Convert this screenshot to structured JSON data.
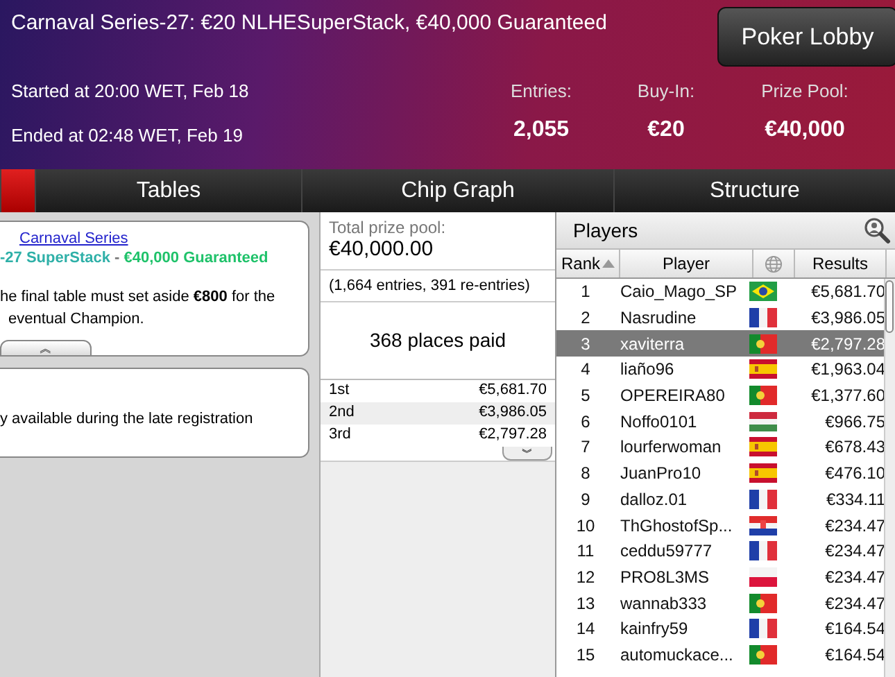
{
  "header": {
    "title": "Carnaval Series-27: €20 NLHESuperStack, €40,000 Guaranteed",
    "lobby_button": "Poker Lobby",
    "started": "Started at 20:00 WET, Feb 18",
    "ended": "Ended at 02:48 WET, Feb 19",
    "stats": [
      {
        "label": "Entries:",
        "value": "2,055"
      },
      {
        "label": "Buy-In:",
        "value": "€20"
      },
      {
        "label": "Prize Pool:",
        "value": "€40,000"
      }
    ]
  },
  "tabs": [
    {
      "selected": true
    },
    {
      "label": "Tables",
      "selected": false
    },
    {
      "label": "Chip Graph",
      "selected": false
    },
    {
      "label": "Structure",
      "selected": false
    }
  ],
  "info": {
    "link": "Carnaval Series",
    "subtitle_parts": [
      {
        "text": "-27 SuperStack",
        "color": "#2fb0a8"
      },
      {
        "text": " - ",
        "color": "#777777"
      },
      {
        "text": "€40,000 Guaranteed",
        "color": "#1fc26a"
      }
    ],
    "lines": [
      "he final table must set aside **€800** for the",
      "eventual Champion."
    ],
    "collapse": "︽",
    "note": "y available during the late registration"
  },
  "prizes": {
    "label": "Total prize pool:",
    "total": "€40,000.00",
    "entries": "(1,664 entries, 391 re-entries)",
    "paid": "368 places paid",
    "places": [
      {
        "place": "1st",
        "amount": "€5,681.70"
      },
      {
        "place": "2nd",
        "amount": "€3,986.05"
      },
      {
        "place": "3rd",
        "amount": "€2,797.28"
      }
    ],
    "expand": "︾"
  },
  "players": {
    "title": "Players",
    "columns": [
      "Rank",
      "Player",
      "Results"
    ],
    "rows": [
      {
        "rank": "1",
        "name": "Caio_Mago_SP",
        "kind": "br",
        "result": "€5,681.70",
        "selected": false
      },
      {
        "rank": "2",
        "name": "Nasrudine",
        "kind": "fr",
        "result": "€3,986.05",
        "selected": false
      },
      {
        "rank": "3",
        "name": "xaviterra",
        "kind": "pt",
        "result": "€2,797.28",
        "selected": true
      },
      {
        "rank": "4",
        "name": "liaño96",
        "kind": "es",
        "result": "€1,963.04",
        "selected": false
      },
      {
        "rank": "5",
        "name": "OPEREIRA80",
        "kind": "pt",
        "result": "€1,377.60",
        "selected": false
      },
      {
        "rank": "6",
        "name": "Noffo0101",
        "kind": "hu",
        "result": "€966.75",
        "selected": false
      },
      {
        "rank": "7",
        "name": "lourferwoman",
        "kind": "es",
        "result": "€678.43",
        "selected": false
      },
      {
        "rank": "8",
        "name": "JuanPro10",
        "kind": "es",
        "result": "€476.10",
        "selected": false
      },
      {
        "rank": "9",
        "name": "dalloz.01",
        "kind": "fr",
        "result": "€334.11",
        "selected": false
      },
      {
        "rank": "10",
        "name": "ThGhostofSp...",
        "kind": "hr",
        "result": "€234.47",
        "selected": false
      },
      {
        "rank": "11",
        "name": "ceddu59777",
        "kind": "fr",
        "result": "€234.47",
        "selected": false
      },
      {
        "rank": "12",
        "name": "PRO8L3MS",
        "kind": "pl",
        "result": "€234.47",
        "selected": false
      },
      {
        "rank": "13",
        "name": "wannab333",
        "kind": "pt",
        "result": "€234.47",
        "selected": false
      },
      {
        "rank": "14",
        "name": "kainfry59",
        "kind": "fr",
        "result": "€164.54",
        "selected": false
      },
      {
        "rank": "15",
        "name": "automuckace...",
        "kind": "pt",
        "result": "€164.54",
        "selected": false
      }
    ]
  }
}
